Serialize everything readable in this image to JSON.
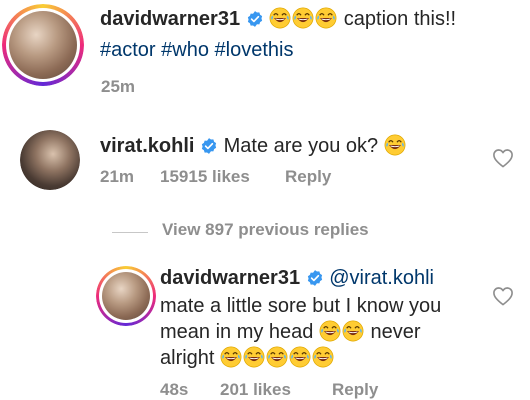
{
  "post": {
    "username": "davidwarner31",
    "caption_text": "caption this!!",
    "caption_emoji_count": 3,
    "hashtags": "#actor #who #lovethis",
    "time": "25m"
  },
  "comment": {
    "username": "virat.kohli",
    "text": "Mate are you ok?",
    "time": "21m",
    "likes": "15915 likes",
    "reply_label": "Reply"
  },
  "view_replies": "View 897 previous replies",
  "reply": {
    "username": "davidwarner31",
    "mention": "@virat.kohli",
    "line2": "mate a little sore but I know you",
    "line3_a": "mean in my head",
    "line3_b": "never",
    "line4": "alright",
    "time": "48s",
    "likes": "201 likes",
    "reply_label": "Reply"
  },
  "colors": {
    "text": "#262626",
    "secondary": "#8e8e8e",
    "link": "#00376b",
    "verified": "#3897f0"
  },
  "icons": [
    "verified-badge-icon",
    "laughing-emoji-icon",
    "heart-outline-icon"
  ]
}
